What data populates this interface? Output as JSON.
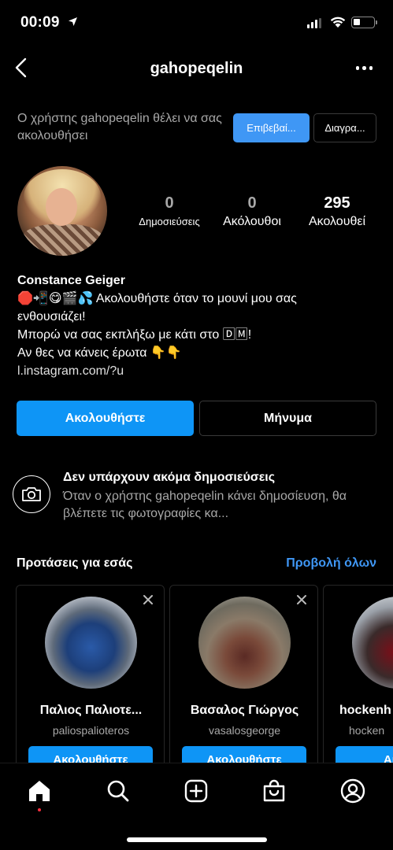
{
  "status_bar": {
    "time": "00:09"
  },
  "header": {
    "title": "gahopeqelin"
  },
  "follow_request": {
    "text": "Ο χρήστης gahopeqelin θέλει να σας ακολουθήσει",
    "confirm_label": "Επιβεβαί...",
    "delete_label": "Διαγρα..."
  },
  "profile": {
    "stats": [
      {
        "value": "0",
        "label": "Δημοσιεύσεις"
      },
      {
        "value": "0",
        "label": "Ακόλουθοι"
      },
      {
        "value": "295",
        "label": "Ακολουθεί"
      }
    ],
    "name": "Constance Geiger",
    "bio_lines": [
      "🛑📲😋🎬💦 Ακολουθήστε όταν το μουνί μου σας",
      "ενθουσιάζει!",
      "Μπορώ να σας εκπλήξω με κάτι στο 🄳🄼!",
      "Αν θες να κάνεις έρωτα 👇👇"
    ],
    "link": "l.instagram.com/?u"
  },
  "actions": {
    "follow_label": "Ακολουθήστε",
    "message_label": "Μήνυμα"
  },
  "empty_posts": {
    "title": "Δεν υπάρχουν ακόμα δημοσιεύσεις",
    "description": "Όταν ο χρήστης gahopeqelin κάνει δημοσίευση, θα βλέπετε τις φωτογραφίες κα..."
  },
  "suggestions": {
    "title": "Προτάσεις για εσάς",
    "see_all_label": "Προβολή όλων",
    "cards": [
      {
        "name": "Παλιος Παλιοτε...",
        "username": "paliospalioteros",
        "follow_label": "Ακολουθήστε"
      },
      {
        "name": "Βασαλος Γιώργος",
        "username": "vasalosgeorge",
        "follow_label": "Ακολουθήστε"
      },
      {
        "name": "hockenh",
        "username": "hocken",
        "follow_label": "Ακολ"
      }
    ]
  },
  "tabbar": {
    "tabs": [
      "home-icon",
      "search-icon",
      "new-post-icon",
      "shop-icon",
      "profile-icon"
    ]
  },
  "colors": {
    "accent": "#0e95f6",
    "link": "#3f97f5",
    "notification_dot": "#ff3040"
  }
}
